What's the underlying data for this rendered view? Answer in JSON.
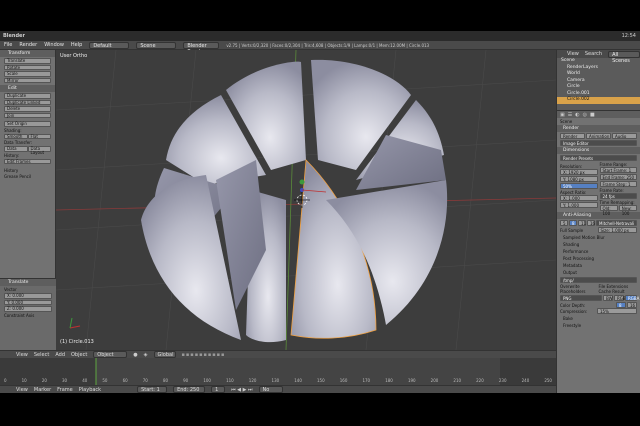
{
  "system": {
    "app": "Blender",
    "clock": "12:54"
  },
  "header": {
    "menus": [
      "File",
      "Render",
      "Window",
      "Help"
    ],
    "layout": "Default",
    "scene": "Scene",
    "engine": "Blender Render",
    "info": "v2.75 | Verts:0/2,320 | Faces:0/2,304 | Tris:4,608 | Objects:1/9 | Lamps:0/1 | Mem:12.00M | Circle.013"
  },
  "toolshelf": {
    "transform_title": "Transform",
    "transform_buttons": [
      "Translate",
      "Rotate",
      "Scale",
      "Mirror"
    ],
    "edit_title": "Edit",
    "edit_buttons": [
      "Duplicate",
      "Duplicate Linked",
      "Delete",
      "Join"
    ],
    "set_origin": "Set Origin",
    "shading_label": "Shading:",
    "shading_buttons": [
      "Smooth",
      "Flat"
    ],
    "data_transfer_label": "Data Transfer:",
    "data_transfer_buttons": [
      "Data",
      "Data Layout"
    ],
    "history_label": "History:",
    "keyframes_button": "Edit Frames",
    "history_panel": "History",
    "grease_panel": "Grease Pencil"
  },
  "operator": {
    "title": "Translate",
    "vector_label": "Vector",
    "x": "X: 0.000",
    "y": "Y: 0.000",
    "z": "Z: 0.000",
    "constraint_label": "Constraint Axis"
  },
  "viewport": {
    "title": "User Ortho",
    "object_label": "(1) Circle.013"
  },
  "viewport_header": {
    "items": [
      "View",
      "Select",
      "Add",
      "Object"
    ],
    "mode": "Object Mode",
    "pivot": "Global"
  },
  "timeline": {
    "ticks": [
      "0",
      "10",
      "20",
      "30",
      "40",
      "50",
      "60",
      "70",
      "80",
      "90",
      "100",
      "110",
      "120",
      "130",
      "140",
      "150",
      "160",
      "170",
      "180",
      "190",
      "200",
      "210",
      "220",
      "230",
      "240",
      "250"
    ]
  },
  "timeline_header": {
    "items": [
      "View",
      "Marker",
      "Frame",
      "Playback"
    ],
    "start": "Start: 1",
    "end": "End: 250",
    "current": "1",
    "sync": "No Sync"
  },
  "outliner": {
    "tabs": [
      "View",
      "Search",
      "All Scenes"
    ],
    "items": [
      {
        "label": "Scene",
        "selected": false
      },
      {
        "label": "RenderLayers",
        "selected": false
      },
      {
        "label": "World",
        "selected": false
      },
      {
        "label": "Camera",
        "selected": false
      },
      {
        "label": "Circle",
        "selected": false
      },
      {
        "label": "Circle.001",
        "selected": false
      },
      {
        "label": "Circle.002",
        "selected": true
      }
    ]
  },
  "properties": {
    "scene_label": "Scene",
    "render_title": "Render",
    "render_buttons": [
      "Render",
      "Animation",
      "Audio"
    ],
    "display": "Image Editor",
    "dimensions_title": "Dimensions",
    "presets": "Render Presets",
    "resolution_label": "Resolution:",
    "res_x": "X: 1920 px",
    "res_y": "Y: 1080 px",
    "res_pct": "50%",
    "frame_range_label": "Frame Range:",
    "start_frame": "Start Frame: 1",
    "end_frame": "End Frame: 250",
    "frame_step": "Frame Step: 1",
    "aspect_label": "Aspect Ratio:",
    "aspect_x": "X: 1.000",
    "aspect_y": "Y: 1.000",
    "frame_rate_label": "Frame Rate:",
    "fps": "24 fps",
    "remapping_label": "Time Remapping:",
    "remap_old": "Old: 100",
    "remap_new": "New: 100",
    "antialias_title": "Anti-Aliasing",
    "aa_samples": [
      "5",
      "8",
      "11",
      "16"
    ],
    "aa_filter": "Mitchell-Netravali",
    "full_sample": "Full Sample",
    "size": "Size: 1.000 px",
    "collapsed": [
      "Sampled Motion Blur",
      "Shading",
      "Performance",
      "Post Processing",
      "Metadata",
      "Output"
    ],
    "output_path": "/tmp/",
    "overwrite": "Overwrite",
    "file_ext": "File Extensions",
    "placeholders": "Placeholders",
    "cache_result": "Cache Result",
    "format": "PNG",
    "color_modes": [
      "BW",
      "RGB",
      "RGBA"
    ],
    "color_depth": "Color Depth:",
    "depth_vals": [
      "8",
      "16"
    ],
    "compression": "Compression:",
    "compression_val": "15%",
    "bake_title": "Bake",
    "freestyle_title": "Freestyle"
  },
  "colors": {
    "accent": "#d9a24a",
    "viewport_bg": "#3d3d3d",
    "panel": "#727272"
  }
}
